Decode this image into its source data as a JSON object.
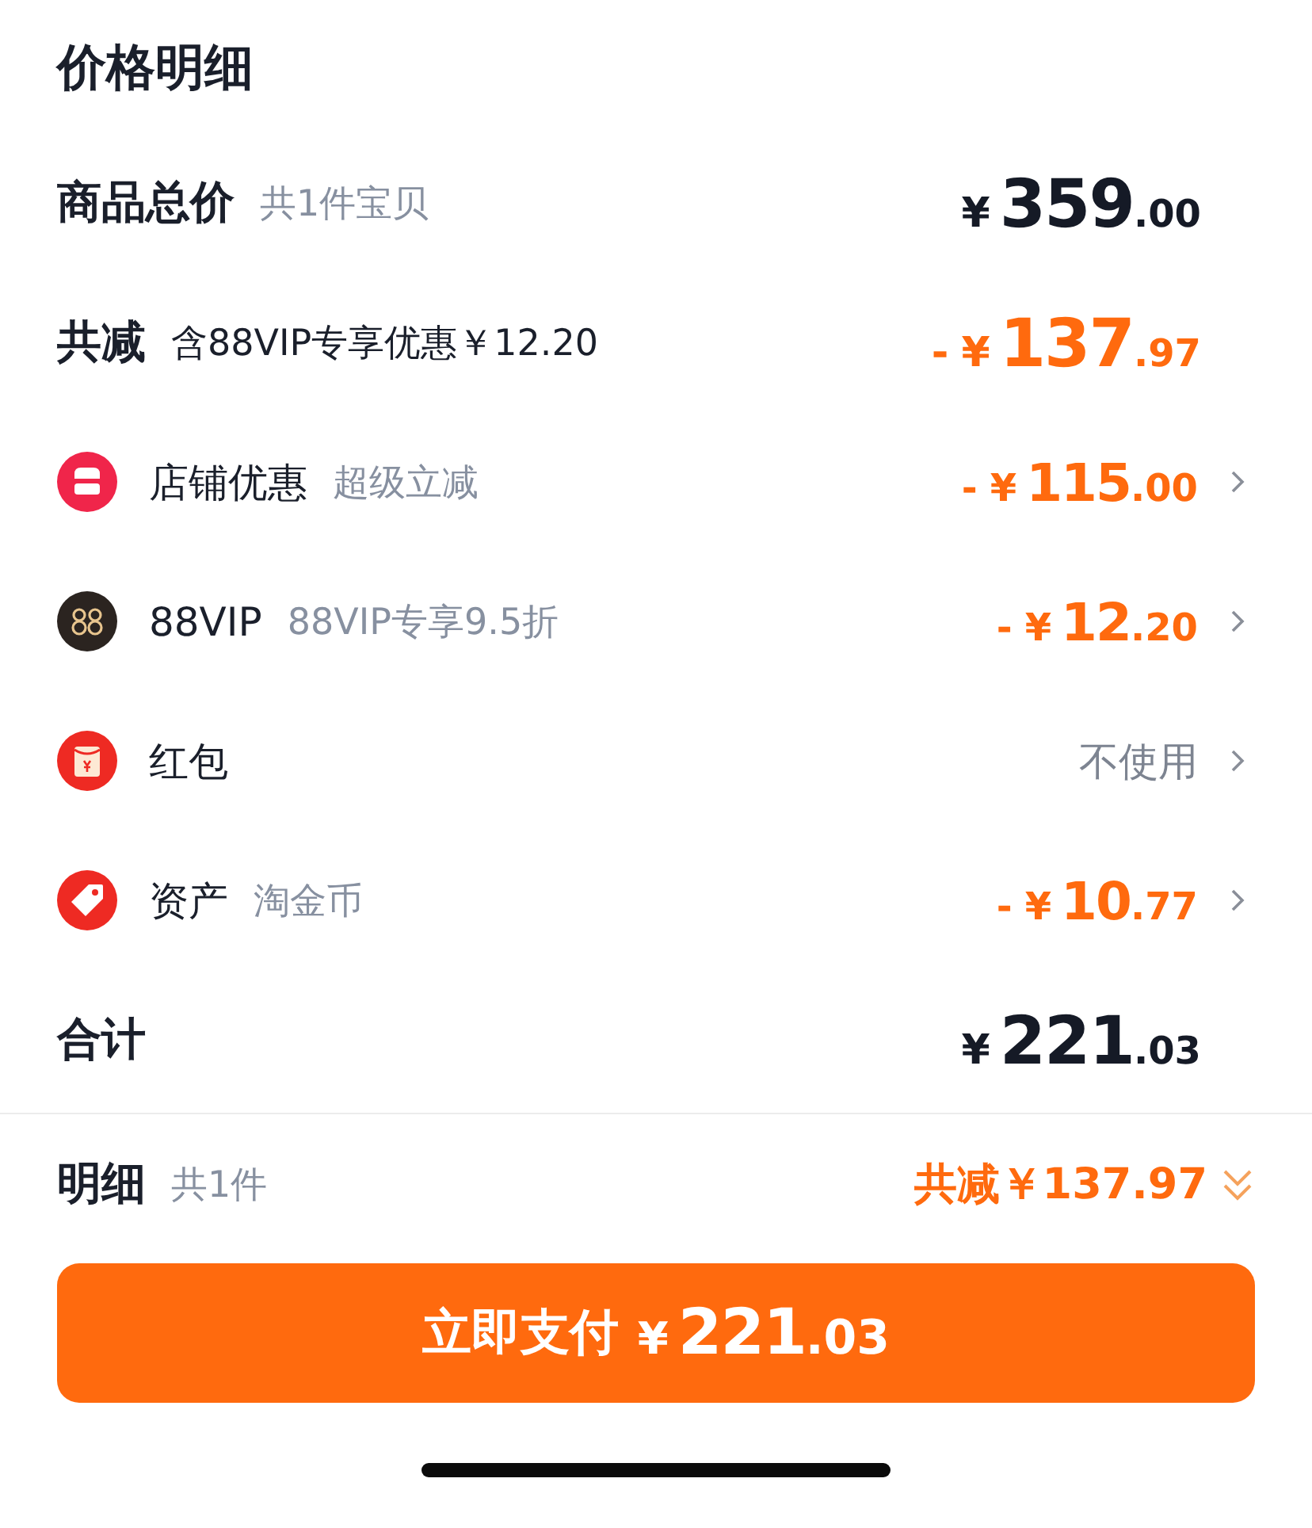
{
  "title": "价格明细",
  "subtotal": {
    "label": "商品总价",
    "note": "共1件宝贝",
    "price": {
      "currency": "¥",
      "integer": "359",
      "decimal": ".00"
    }
  },
  "discount_total": {
    "label": "共减",
    "note": "含88VIP专享优惠￥12.20",
    "price": {
      "sign": "-",
      "currency": "¥",
      "integer": "137",
      "decimal": ".97"
    }
  },
  "items": [
    {
      "label": "店铺优惠",
      "note": "超级立减",
      "kind": "price",
      "price": {
        "sign": "-",
        "currency": "¥",
        "integer": "115",
        "decimal": ".00"
      }
    },
    {
      "label": "88VIP",
      "note": "88VIP专享9.5折",
      "kind": "price",
      "price": {
        "sign": "-",
        "currency": "¥",
        "integer": "12",
        "decimal": ".20"
      }
    },
    {
      "label": "红包",
      "kind": "text",
      "value": "不使用"
    },
    {
      "label": "资产",
      "note": "淘金币",
      "kind": "price",
      "price": {
        "sign": "-",
        "currency": "¥",
        "integer": "10",
        "decimal": ".77"
      }
    }
  ],
  "total": {
    "label": "合计",
    "price": {
      "currency": "¥",
      "integer": "221",
      "decimal": ".03"
    }
  },
  "details": {
    "label": "明细",
    "note": "共1件",
    "summary": "共减￥137.97",
    "expanded": false
  },
  "pay_button": {
    "label": "立即支付",
    "price": {
      "currency": "¥",
      "integer": "221",
      "decimal": ".03"
    }
  }
}
